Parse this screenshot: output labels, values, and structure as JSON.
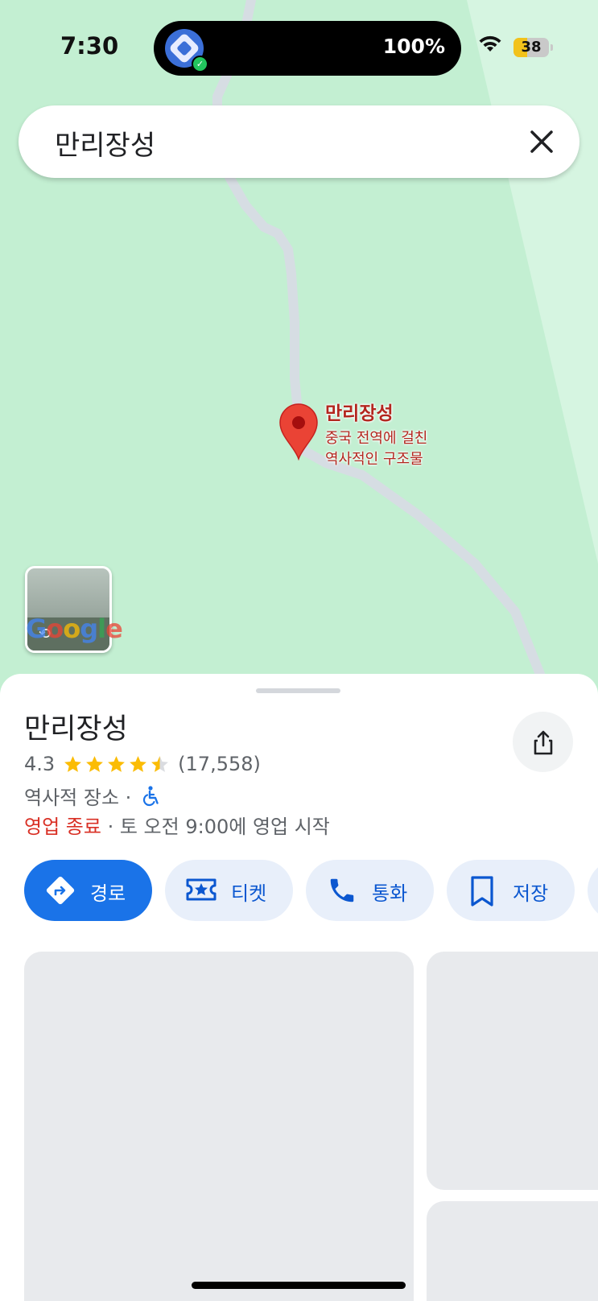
{
  "status_bar": {
    "time": "7:30",
    "island_battery": "100%",
    "battery_level": "38",
    "wifi_icon": "wifi-icon",
    "app_icon": "app-shield-icon"
  },
  "search": {
    "query": "만리장성",
    "clear_icon": "close-icon"
  },
  "map": {
    "pin_title": "만리장성",
    "pin_subtitle_line1": "중국 전역에 걸친",
    "pin_subtitle_line2": "역사적인 구조물",
    "google_logo": "Google",
    "pin_color": "#ea4335",
    "road_color": "#d6dde3"
  },
  "place": {
    "name": "만리장성",
    "rating": "4.3",
    "rating_value": 4.3,
    "review_count": "(17,558)",
    "category": "역사적 장소 ·",
    "status": "영업 종료",
    "hours_note": " · 토 오전 9:00에 영업 시작"
  },
  "actions": [
    {
      "label": "경로",
      "icon": "directions-icon"
    },
    {
      "label": "티켓",
      "icon": "ticket-icon"
    },
    {
      "label": "통화",
      "icon": "phone-icon"
    },
    {
      "label": "저장",
      "icon": "bookmark-icon"
    }
  ],
  "colors": {
    "accent": "#1a73e8",
    "star": "#fbbc04",
    "closed": "#d93025",
    "map_green": "#c3efd2"
  }
}
